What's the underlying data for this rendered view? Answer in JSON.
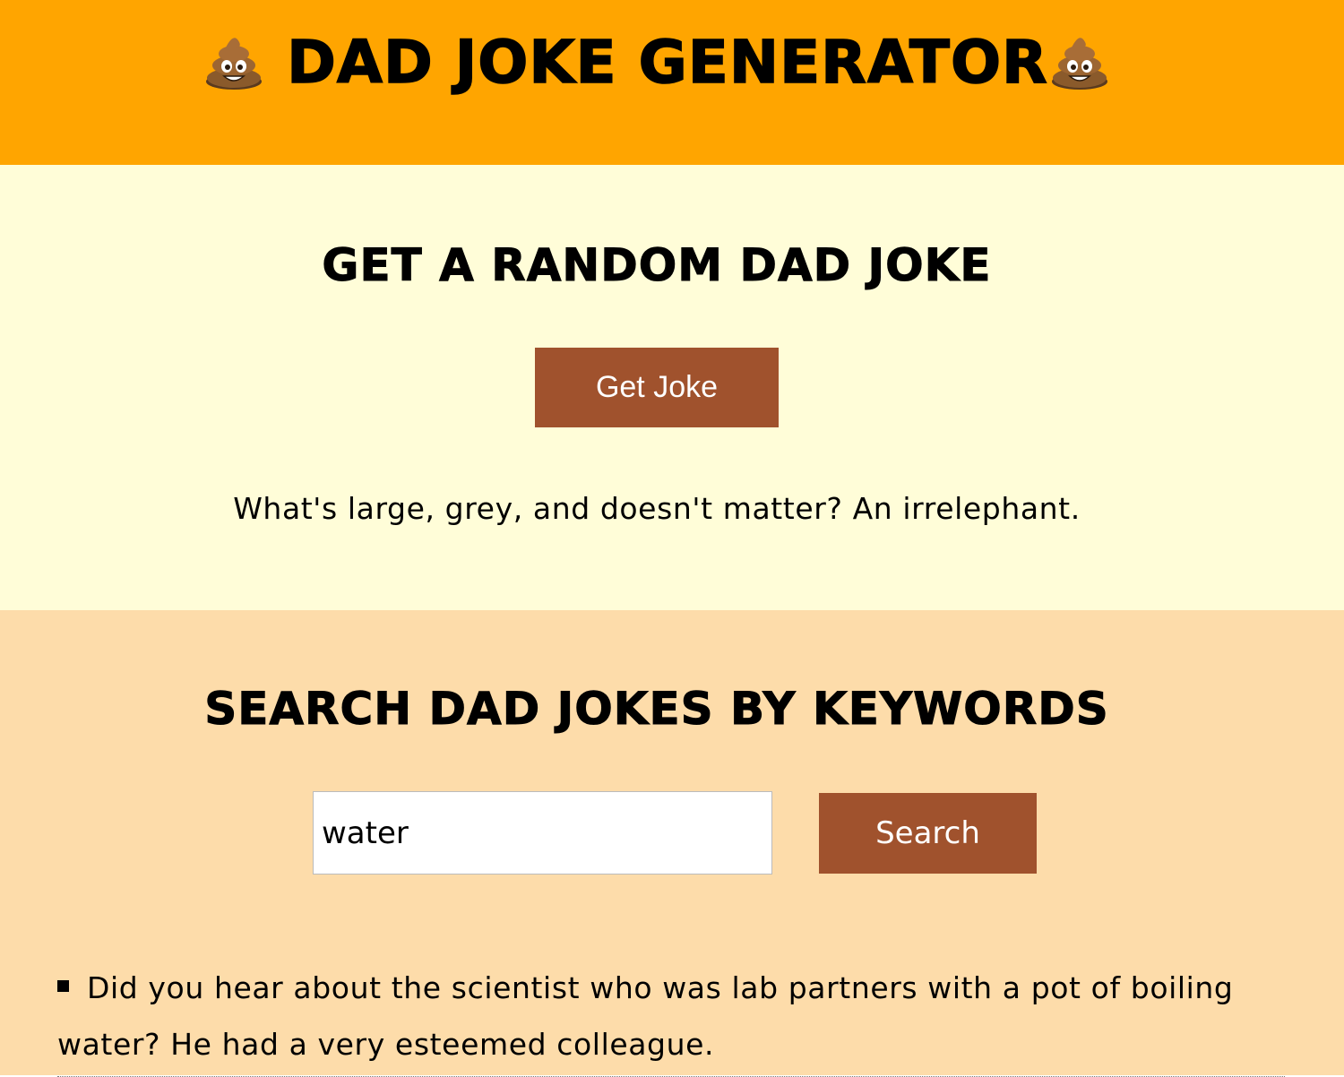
{
  "header": {
    "title": "DAD JOKE GENERATOR",
    "icon_left": "poop-emoji-icon",
    "icon_right": "poop-emoji-icon",
    "background": "#FFA500"
  },
  "random_section": {
    "heading": "GET A RANDOM DAD JOKE",
    "button_label": "Get Joke",
    "joke": "What's large, grey, and doesn't matter? An irrelephant.",
    "background": "#FFFDD8",
    "button_color": "#A0522D"
  },
  "search_section": {
    "heading": "SEARCH DAD JOKES BY KEYWORDS",
    "input_value": "water",
    "button_label": "Search",
    "background": "#FDDCAA",
    "button_color": "#A0522D",
    "results": [
      "Did you hear about the scientist who was lab partners with a pot of boiling water? He had a very esteemed colleague."
    ]
  }
}
